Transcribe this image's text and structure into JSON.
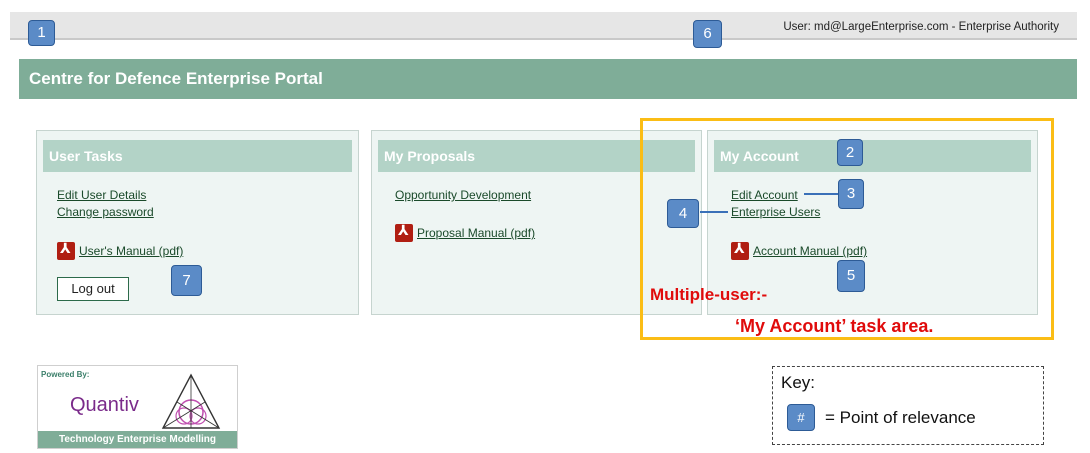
{
  "window": {
    "user_info": "User: md@LargeEnterprise.com - Enterprise Authority"
  },
  "header": {
    "title": "Centre for Defence Enterprise Portal"
  },
  "panels": {
    "user_tasks": {
      "title": "User Tasks",
      "links": [
        "Edit User Details",
        "Change password"
      ],
      "manual": "User's Manual (pdf)",
      "logout": "Log out"
    },
    "my_proposals": {
      "title": "My Proposals",
      "links": [
        "Opportunity Development"
      ],
      "manual": "Proposal Manual (pdf)"
    },
    "my_account": {
      "title": "My Account",
      "links": [
        "Edit Account",
        "Enterprise Users"
      ],
      "manual": "Account Manual (pdf)"
    }
  },
  "annotations": {
    "badges": [
      "1",
      "2",
      "3",
      "4",
      "5",
      "6",
      "7"
    ],
    "multi_user_line1": "Multiple-user:-",
    "multi_user_line2": "‘My Account’ task area.",
    "highlight_color": "#fbbd15",
    "badge_color": "#5b8bc7"
  },
  "logo": {
    "powered_by": "Powered By:",
    "name": "Quantiv",
    "strip": "Technology Enterprise Modelling"
  },
  "key": {
    "title": "Key:",
    "badge": "#",
    "text": "= Point of relevance"
  },
  "icons": {
    "pdf": "pdf-icon",
    "logo_triangle": "triangle-logo-icon"
  }
}
